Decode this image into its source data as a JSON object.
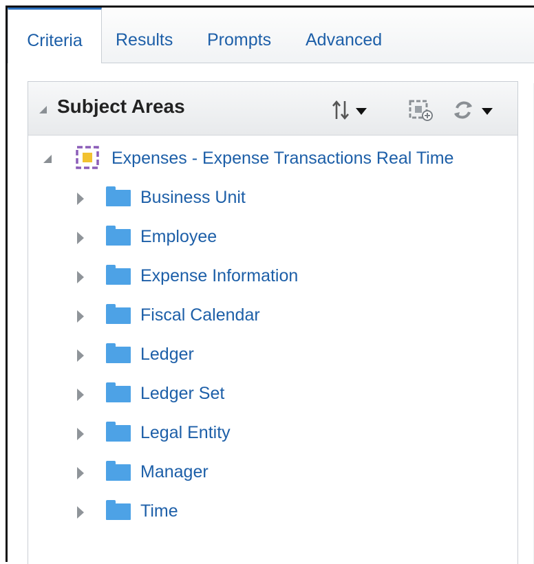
{
  "tabs": [
    {
      "label": "Criteria",
      "active": true
    },
    {
      "label": "Results",
      "active": false
    },
    {
      "label": "Prompts",
      "active": false
    },
    {
      "label": "Advanced",
      "active": false
    }
  ],
  "subject_areas": {
    "title": "Subject Areas",
    "root": {
      "label": "Expenses - Expense Transactions Real Time",
      "icon": "subject-area-icon",
      "children": [
        {
          "label": "Business Unit",
          "icon": "folder-icon"
        },
        {
          "label": "Employee",
          "icon": "folder-icon"
        },
        {
          "label": "Expense Information",
          "icon": "folder-icon"
        },
        {
          "label": "Fiscal Calendar",
          "icon": "folder-icon"
        },
        {
          "label": "Ledger",
          "icon": "folder-icon"
        },
        {
          "label": "Ledger Set",
          "icon": "folder-icon"
        },
        {
          "label": "Legal Entity",
          "icon": "folder-icon"
        },
        {
          "label": "Manager",
          "icon": "folder-icon"
        },
        {
          "label": "Time",
          "icon": "folder-icon"
        }
      ]
    },
    "toolbar_icons": [
      "sort-icon",
      "add-subject-area-icon",
      "refresh-icon"
    ]
  },
  "colors": {
    "link": "#1d5fa8",
    "folder": "#4da2e6",
    "active_tab_border": "#2a6fbd"
  }
}
